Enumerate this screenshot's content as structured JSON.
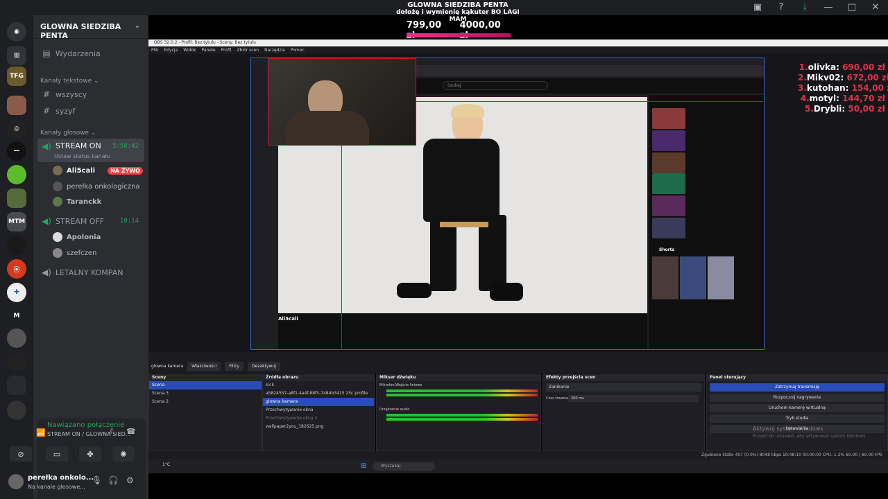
{
  "overlay": {
    "title": "GLOWNA SIEDZIBA PENTA",
    "subtitle": "dołożę i wymienię kąkuter BO LAGI MAM",
    "amount_current": "799,00 zł",
    "amount_goal": "4000,00 zł"
  },
  "server": {
    "name": "GLOWNA SIEDZIBA PENTA",
    "events_label": "Wydarzenia",
    "text_category": "Kanały tekstowe",
    "text_channels": [
      "wszyscy",
      "syzyf"
    ],
    "voice_category": "Kanały głosowe",
    "voice_channels": [
      {
        "name": "STREAM ON",
        "timer": "5:58:42",
        "status": "Ustaw status kanału",
        "users": [
          {
            "name": "Ali5cali",
            "badge": "NA ŻYWO"
          },
          {
            "name": "perełka onkologiczna",
            "badge": ""
          },
          {
            "name": "Taranckk",
            "badge": ""
          }
        ]
      },
      {
        "name": "STREAM OFF",
        "timer": "10:14",
        "users": [
          {
            "name": "Apolonia"
          },
          {
            "name": "szefczen"
          }
        ]
      },
      {
        "name": "LETALNY KOMPAN"
      }
    ]
  },
  "connection": {
    "status": "Nawiązano połączenie",
    "channel": "STREAM ON / GLOWNA SIED..."
  },
  "user": {
    "name": "perełka onkolo...",
    "status": "Na kanale głosowe..."
  },
  "leaderboard": [
    {
      "rank": "1.",
      "name": "olivka:",
      "amount": "690,00 zł"
    },
    {
      "rank": "2.",
      "name": "Mikv02:",
      "amount": "672,00 zł"
    },
    {
      "rank": "3.",
      "name": "kutohan:",
      "amount": "154,00 zł"
    },
    {
      "rank": "4.",
      "name": "motyl:",
      "amount": "144,70 zł"
    },
    {
      "rank": "5.",
      "name": "Drybli:",
      "amount": "50,00 zł"
    }
  ],
  "obs": {
    "title": "OBS 32.0.2 - Profil: Bez tytułu - Sceny: Bez tytułu",
    "menu": [
      "Plik",
      "Edycja",
      "Widok",
      "Panele",
      "Profil",
      "Zbiór scen",
      "Narzędzia",
      "Pomoc"
    ],
    "tabs": [
      "glowna kamera",
      "Właściwości",
      "Filtry",
      "Dezaktywuj"
    ],
    "scenes_header": "Sceny",
    "scenes": [
      "Scena",
      "Scena 3",
      "Scena 2"
    ],
    "sources_header": "Źródła obrazu",
    "sources": [
      "kick",
      "a5824557-a8f1-4a4f-88f5-7484b3415 25c profile",
      "glowna kamera",
      "Przechwytywanie okna",
      "Przechwytywanie okna 2",
      "wallpaper2you_182625.png"
    ],
    "mixer_header": "Mikser dźwięku",
    "mixer_channels": [
      "Mikrofon/Wejście liniowe",
      "Urządzenie audio"
    ],
    "transitions_header": "Efekty przejścia scen",
    "transition_value": "Zanikanie",
    "duration_label": "Czas trwania",
    "duration_value": "300 ms",
    "controls_header": "Panel sterujący",
    "controls": [
      "Zatrzymaj transmisję",
      "Rozpocznij nagrywanie",
      "Uruchom kamerę wirtualną",
      "Tryb studia",
      "Ustawienia"
    ],
    "footer": "Zgubione klatki 407 (0.0%)   8048 kbps   10:48:10   00:00:00   CPU: 1.2%   60.00 / 60.00 FPS"
  },
  "windows": {
    "search": "Wyszukaj",
    "activate_title": "Aktywuj system Windows",
    "activate_sub": "Przejdź do ustawień, aby aktywować system Windows.",
    "weather": "1°C"
  },
  "youtube": {
    "search_placeholder": "Szukaj",
    "channel": "Ali5cali",
    "shorts": "Shorts"
  }
}
